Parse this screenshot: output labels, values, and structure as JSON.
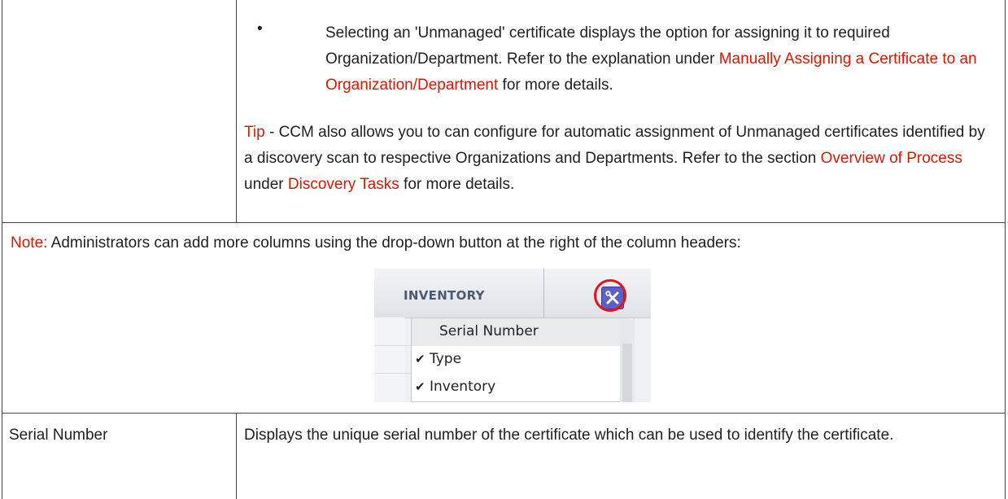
{
  "row1": {
    "bullet_symbol": "•",
    "bullet": {
      "text_before": "Selecting an 'Unmanaged' certificate displays the option for assigning it to required Organization/Department. Refer to the explanation under ",
      "link": "Manually Assigning a Certificate to an Organization/Department",
      "text_after": " for more details."
    },
    "tip": {
      "label": "Tip",
      "text_before": " - CCM also allows you to can configure for automatic assignment of Unmanaged certificates identified by a discovery scan to respective Organizations and Departments. Refer to the section ",
      "link1": "Overview of Process",
      "text_middle": " under ",
      "link2": "Discovery Tasks",
      "text_after": " for more details."
    }
  },
  "row2": {
    "note_label": "Note:",
    "note_text": " Administrators can add more columns using the drop-down button at the right of the column headers:",
    "screenshot": {
      "header_title": "INVENTORY",
      "column_settings_icon": "wrench-icon",
      "menu_items": [
        {
          "label": "Serial Number",
          "checked": false,
          "check": ""
        },
        {
          "label": "Type",
          "checked": true,
          "check": "✔"
        },
        {
          "label": "Inventory",
          "checked": true,
          "check": "✔"
        }
      ]
    }
  },
  "row3": {
    "field": "Serial Number",
    "description": "Displays the unique serial number of the certificate which can be used to identify the certificate."
  },
  "colors": {
    "link_red": "#d61a00",
    "highlight_circle": "#e2141c",
    "settings_button": "#5c5fc6"
  }
}
